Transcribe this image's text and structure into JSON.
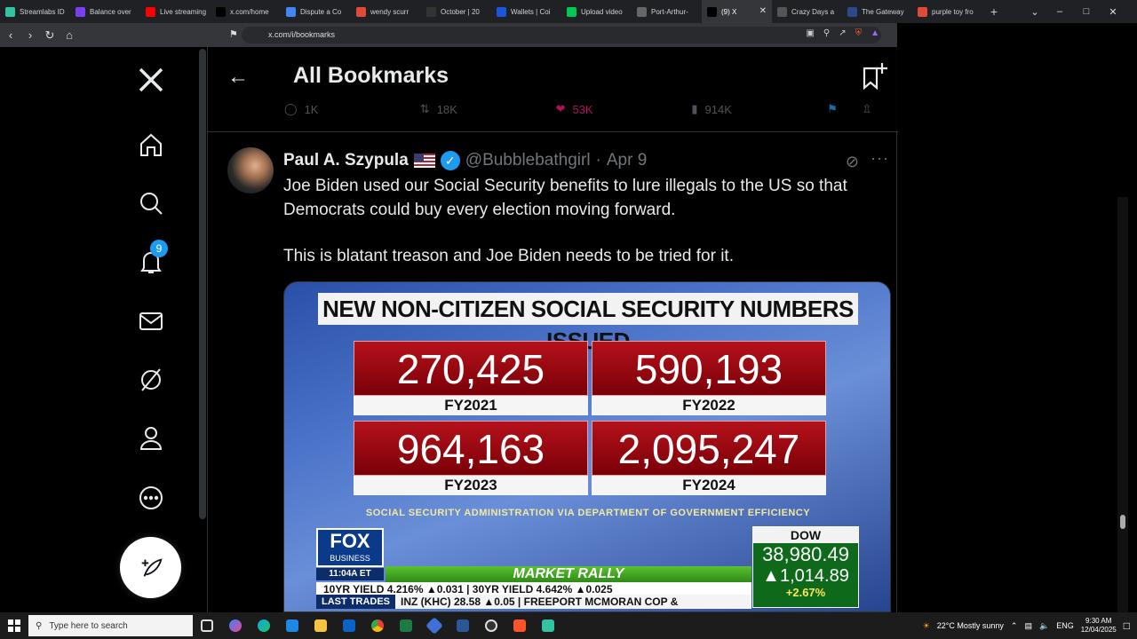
{
  "browser": {
    "tabs": [
      {
        "title": "Streamlabs ID",
        "color": "#31c3a2"
      },
      {
        "title": "Balance over",
        "color": "#7b3ff2"
      },
      {
        "title": "Live streaming",
        "color": "#ff0000"
      },
      {
        "title": "x.com/home",
        "color": "#000000"
      },
      {
        "title": "Dispute a Co",
        "color": "#4285f4"
      },
      {
        "title": "wendy scurr",
        "color": "#e04a3a"
      },
      {
        "title": "October | 20",
        "color": "#333333"
      },
      {
        "title": "Wallets | Coi",
        "color": "#1a56db"
      },
      {
        "title": "Upload video",
        "color": "#00c853"
      },
      {
        "title": "Port-Arthur-",
        "color": "#666666"
      },
      {
        "title": "(9) X",
        "color": "#000000",
        "active": true
      },
      {
        "title": "Crazy Days a",
        "color": "#555555"
      },
      {
        "title": "The Gateway",
        "color": "#2a4a8a"
      },
      {
        "title": "purple toy fro",
        "color": "#e04a3a"
      }
    ],
    "url": "x.com/i/bookmarks"
  },
  "sidebar": {
    "notifications_badge": "9"
  },
  "header": {
    "title": "All Bookmarks"
  },
  "prev_tweet_actions": {
    "replies": "1K",
    "reposts": "18K",
    "likes": "53K",
    "views": "914K"
  },
  "tweet": {
    "name": "Paul A. Szypula",
    "handle": "@Bubblebathgirl",
    "dot": "·",
    "date": "Apr 9",
    "text1": "Joe Biden used our Social Security benefits to lure illegals to the US so that Democrats could buy every election moving forward.",
    "text2": "This is blatant treason and Joe Biden needs to be tried for it."
  },
  "media": {
    "title": "NEW NON-CITIZEN SOCIAL SECURITY NUMBERS ISSUED",
    "boxes": [
      {
        "value": "270,425",
        "year": "FY2021"
      },
      {
        "value": "590,193",
        "year": "FY2022"
      },
      {
        "value": "964,163",
        "year": "FY2023"
      },
      {
        "value": "2,095,247",
        "year": "FY2024"
      }
    ],
    "source": "SOCIAL SECURITY ADMINISTRATION VIA DEPARTMENT OF GOVERNMENT EFFICIENCY",
    "fox_line1": "FOX",
    "fox_line2": "BUSINESS",
    "time": "11:04A ET",
    "rally": "MARKET RALLY",
    "ticker1": "10YR YIELD   4.216% ▲0.031 | 30YR YIELD   4.642% ▲0.025",
    "ticker2_label": "LAST TRADES",
    "ticker2": "INZ (KHC)  28.58  ▲0.05 | FREEPORT MCMORAN COP &",
    "dow_label": "DOW",
    "dow_value": "38,980.49",
    "dow_change": "▲1,014.89",
    "dow_pct": "+2.67%"
  },
  "taskbar": {
    "search_placeholder": "Type here to search",
    "weather": "22°C  Mostly sunny",
    "lang": "ENG",
    "time": "9:30 AM",
    "date": "12/04/2025"
  }
}
